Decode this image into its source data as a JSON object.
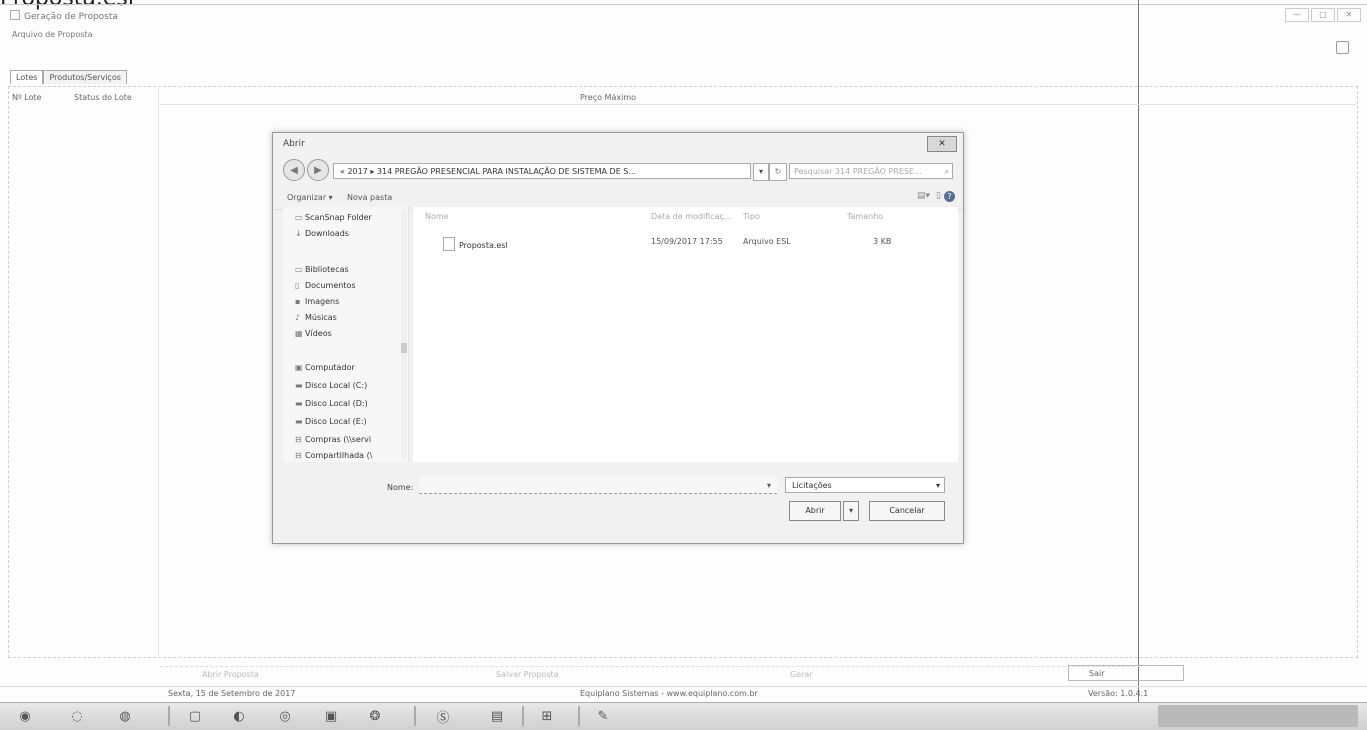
{
  "top_caption": "Proposta.esl",
  "app": {
    "title": "Geração de Proposta",
    "menu": "Arquivo de Proposta",
    "window_controls": [
      "—",
      "▢",
      "✕"
    ]
  },
  "tabs": [
    {
      "label": "Lotes"
    },
    {
      "label": "Produtos/Serviços"
    }
  ],
  "lots_table": {
    "headers": [
      "Nº Lote",
      "Status do Lote"
    ],
    "preco_header": "Preço Máximo"
  },
  "bottom_bar": {
    "items": [
      "Abrir Proposta",
      "Salvar Proposta",
      "Gerar"
    ],
    "sair": "Sair"
  },
  "status": {
    "date": "Sexta, 15 de Setembro de 2017",
    "company": "Equiplano Sistemas - www.equiplano.com.br",
    "version": "Versão: 1.0.4.1"
  },
  "taskbar": {
    "icons": [
      "start-orb",
      "ie-icon",
      "explorer-icon",
      "media-icon",
      "chrome-icon",
      "webcam-icon",
      "acrobat-icon",
      "app-icon",
      "skype-icon",
      "photo-icon",
      "window-icon",
      "pen-icon"
    ]
  },
  "dialog": {
    "title": "Abrir",
    "close": "✕",
    "address_path": "« 2017 ▸ 314 PREGÃO PRESENCIAL PARA INSTALAÇÃO DE SISTEMA DE S...",
    "search_placeholder": "Pesquisar 314 PREGÃO PRESE...",
    "toolbar": {
      "organize": "Organizar ▾",
      "new_folder": "Nova pasta"
    },
    "nav": [
      {
        "label": "ScanSnap Folder",
        "icon": "folder-icon"
      },
      {
        "label": "Downloads",
        "icon": "download-icon"
      },
      {
        "label": "Bibliotecas",
        "icon": "library-icon"
      },
      {
        "label": "Documentos",
        "icon": "document-icon"
      },
      {
        "label": "Imagens",
        "icon": "image-icon"
      },
      {
        "label": "Músicas",
        "icon": "music-icon"
      },
      {
        "label": "Vídeos",
        "icon": "video-icon"
      },
      {
        "label": "Computador",
        "icon": "computer-icon"
      },
      {
        "label": "Disco Local (C:)",
        "icon": "disk-icon"
      },
      {
        "label": "Disco Local (D:)",
        "icon": "disk-icon"
      },
      {
        "label": "Disco Local (E:)",
        "icon": "disk-icon"
      },
      {
        "label": "Compras (\\\\servi",
        "icon": "network-drive-icon"
      },
      {
        "label": "Compartilhada (\\",
        "icon": "network-drive-icon"
      }
    ],
    "columns": [
      "Nome",
      "Data de modificaç...",
      "Tipo",
      "Tamanho"
    ],
    "files": [
      {
        "name": "Proposta.esl",
        "modified": "15/09/2017 17:55",
        "type": "Arquivo ESL",
        "size": "3 KB"
      }
    ],
    "name_label": "Nome:",
    "name_value": "",
    "filter": "Licitações",
    "open_button": "Abrir",
    "cancel_button": "Cancelar"
  }
}
